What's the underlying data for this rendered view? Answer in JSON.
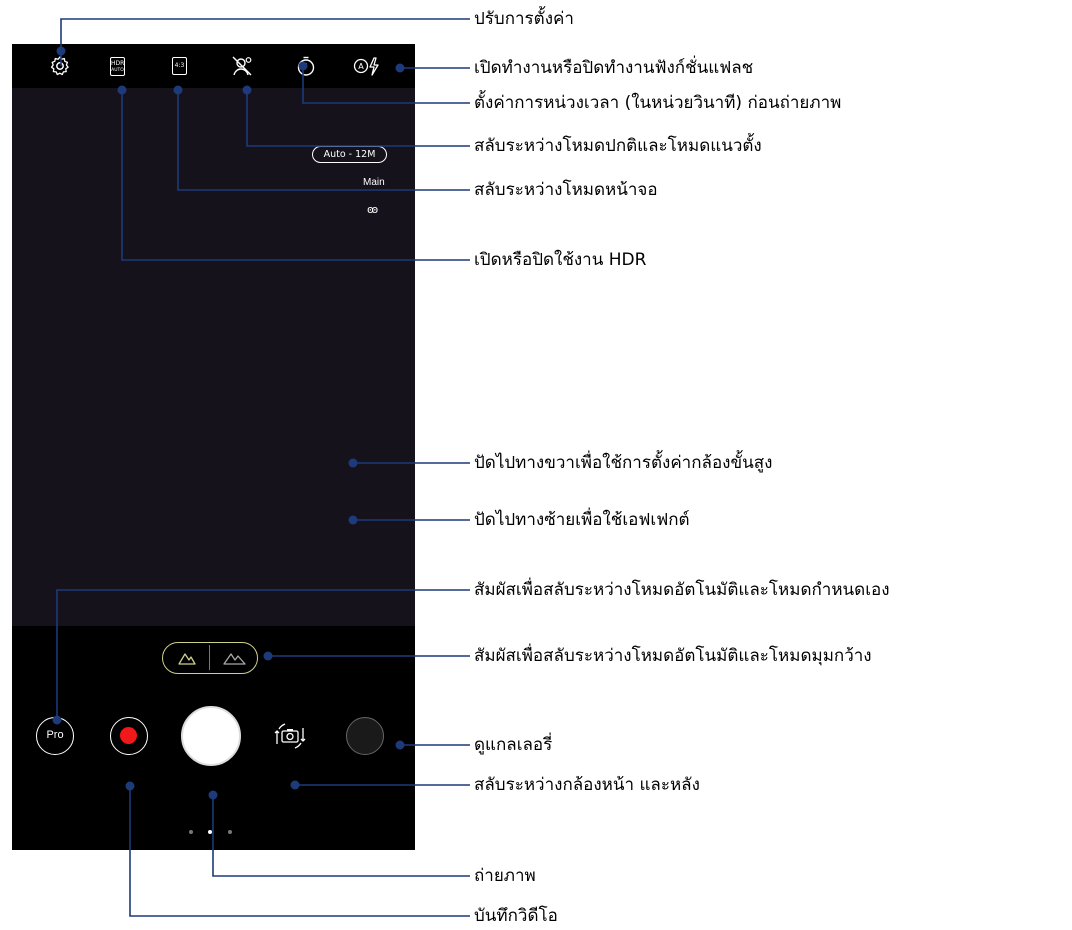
{
  "camera": {
    "resolution_label": "Auto - 12M",
    "lens_label": "Main",
    "hdr_top": "HDR",
    "hdr_bottom": "AUTO",
    "ratio_label": "4:3",
    "pro_label": "Pro",
    "accent_color": "#cfd08a",
    "record_color": "#f01818",
    "page_indicator": {
      "count": 3,
      "active": 1
    },
    "icons": {
      "settings": "gear-icon",
      "hdr": "hdr-icon",
      "ratio": "aspect-ratio-icon",
      "beauty": "beauty-off-icon",
      "timer": "timer-icon",
      "flash": "flash-auto-icon",
      "night": "owl-icon",
      "normal_lens": "mountain-icon",
      "wide_lens": "wide-mountain-icon",
      "switch_camera": "switch-camera-icon"
    }
  },
  "annotations": {
    "settings": "ปรับการตั้งค่า",
    "flash": "เปิดทำงานหรือปิดทำงานฟังก์ชั่นแฟลช",
    "timer": "ตั้งค่าการหน่วงเวลา (ในหน่วยวินาที) ก่อนถ่ายภาพ",
    "portrait": "สลับระหว่างโหมดปกติและโหมดแนวตั้ง",
    "screen_mode": "สลับระหว่างโหมดหน้าจอ",
    "hdr": "เปิดหรือปิดใช้งาน HDR",
    "swipe_right": "ปัดไปทางขวาเพื่อใช้การตั้งค่ากล้องขั้นสูง",
    "swipe_left": "ปัดไปทางซ้ายเพื่อใช้เอฟเฟกต์",
    "pro_mode": "สัมผัสเพื่อสลับระหว่างโหมดอัตโนมัติและโหมดกำหนดเอง",
    "wide_mode": "สัมผัสเพื่อสลับระหว่างโหมดอัตโนมัติและโหมดมุมกว้าง",
    "gallery": "ดูแกลเลอรี่",
    "switch_camera": "สลับระหว่างกล้องหน้า และหลัง",
    "take_photo": "ถ่ายภาพ",
    "record_video": "บันทึกวิดีโอ"
  }
}
